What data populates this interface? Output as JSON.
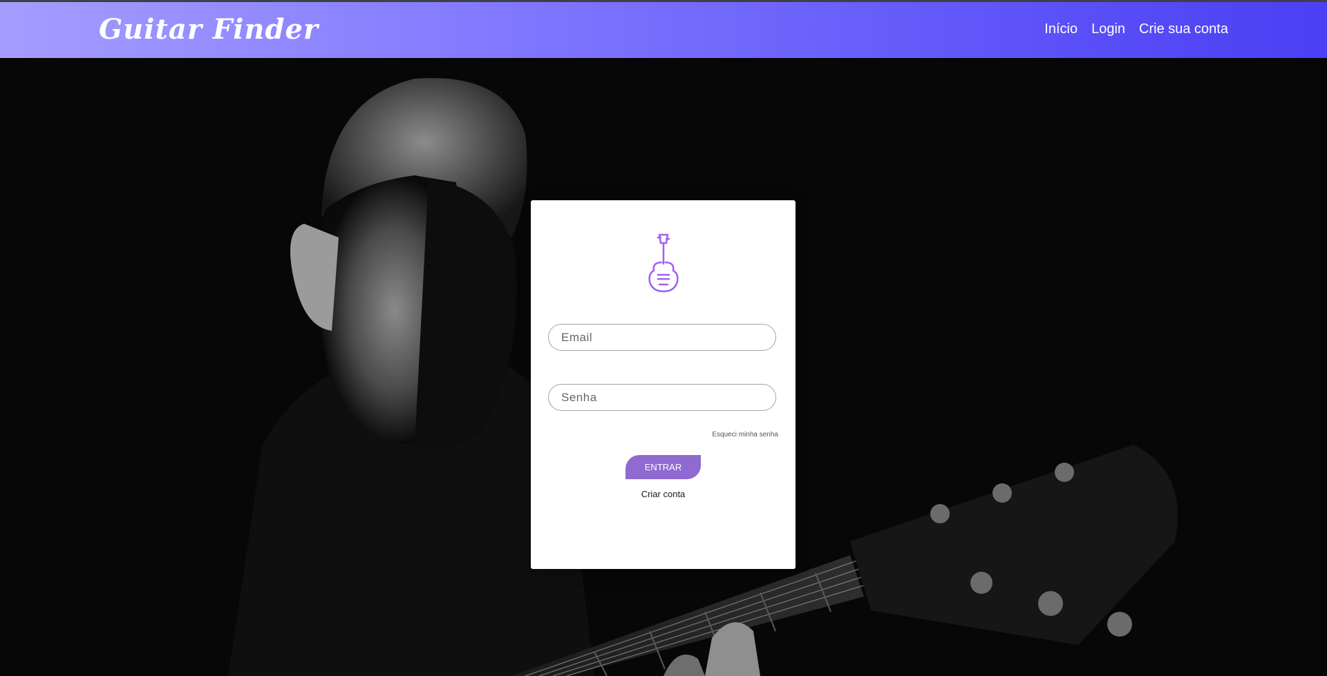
{
  "navbar": {
    "brand": "Guitar Finder",
    "links": [
      {
        "label": "Início"
      },
      {
        "label": "Login"
      },
      {
        "label": "Crie sua conta"
      }
    ],
    "gradient_colors": [
      "#a59dff",
      "#4a3ff4"
    ]
  },
  "hero": {
    "image": "black-and-white-photo-of-man-playing-guitar"
  },
  "login_card": {
    "icon": "guitar-icon",
    "icon_color": "#a25ef0",
    "email_placeholder": "Email",
    "password_placeholder": "Senha",
    "forgot_password": "Esqueci minha senha",
    "submit_label": "ENTRAR",
    "submit_color": "#8f6ad0",
    "create_account": "Criar conta"
  }
}
